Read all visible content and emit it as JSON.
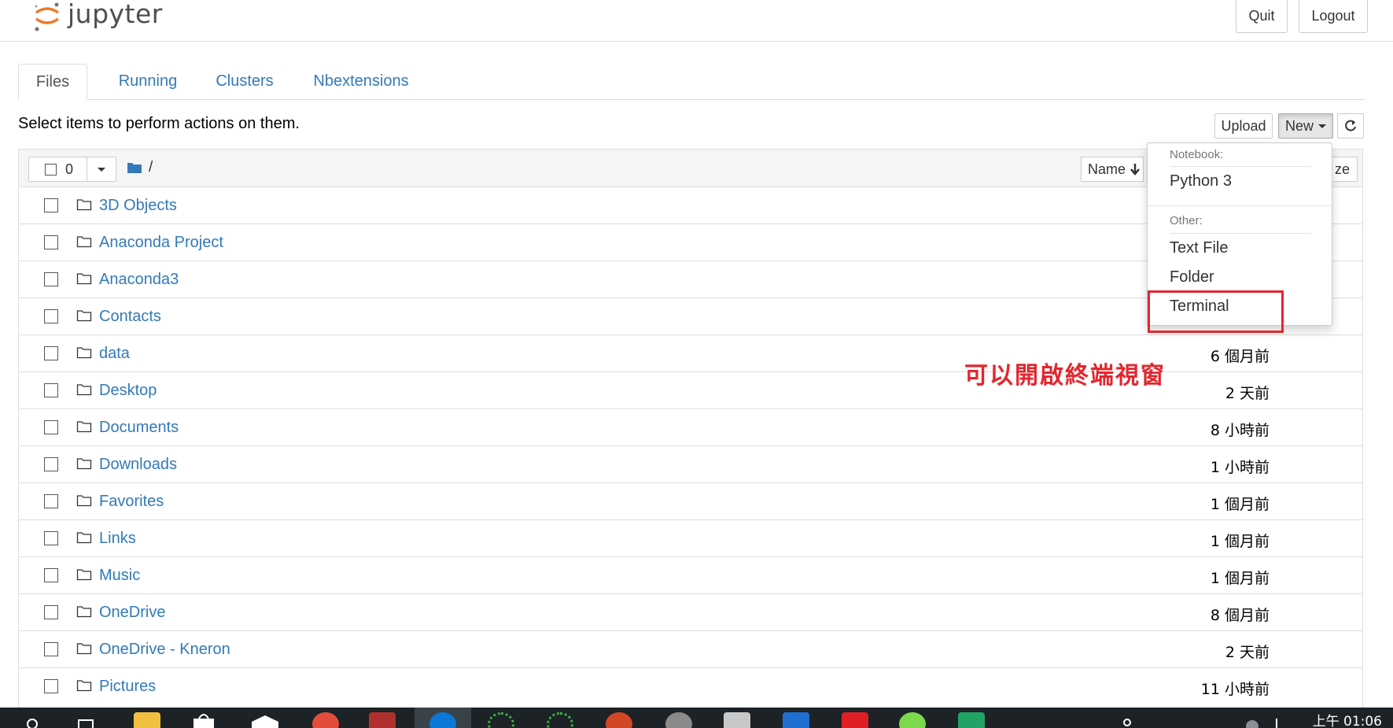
{
  "header": {
    "logo_text": "jupyter",
    "quit_label": "Quit",
    "logout_label": "Logout"
  },
  "tabs": [
    {
      "label": "Files",
      "active": true
    },
    {
      "label": "Running",
      "active": false
    },
    {
      "label": "Clusters",
      "active": false
    },
    {
      "label": "Nbextensions",
      "active": false
    }
  ],
  "toolbar": {
    "instructions": "Select items to perform actions on them.",
    "upload_label": "Upload",
    "new_label": "New",
    "refresh_icon": "refresh-icon"
  },
  "list_header": {
    "selected_count": "0",
    "path": "/",
    "name_sort_label": "Name",
    "size_sort_label": "ze"
  },
  "files": [
    {
      "name": "3D Objects",
      "modified": ""
    },
    {
      "name": "Anaconda Project",
      "modified": ""
    },
    {
      "name": "Anaconda3",
      "modified": ""
    },
    {
      "name": "Contacts",
      "modified": ""
    },
    {
      "name": "data",
      "modified": "6 個月前"
    },
    {
      "name": "Desktop",
      "modified": "2 天前"
    },
    {
      "name": "Documents",
      "modified": "8 小時前"
    },
    {
      "name": "Downloads",
      "modified": "1 小時前"
    },
    {
      "name": "Favorites",
      "modified": "1 個月前"
    },
    {
      "name": "Links",
      "modified": "1 個月前"
    },
    {
      "name": "Music",
      "modified": "1 個月前"
    },
    {
      "name": "OneDrive",
      "modified": "8 個月前"
    },
    {
      "name": "OneDrive - Kneron",
      "modified": "2 天前"
    },
    {
      "name": "Pictures",
      "modified": "11 小時前"
    }
  ],
  "new_menu": {
    "notebook_header": "Notebook:",
    "python3": "Python 3",
    "other_header": "Other:",
    "text_file": "Text File",
    "folder": "Folder",
    "terminal": "Terminal"
  },
  "annotation": "可以開啟終端視窗",
  "taskbar": {
    "clock": "上午 01:06"
  },
  "colors": {
    "link": "#337ab7",
    "annotation_red": "#e3262e",
    "jupyter_orange": "#f37726"
  }
}
